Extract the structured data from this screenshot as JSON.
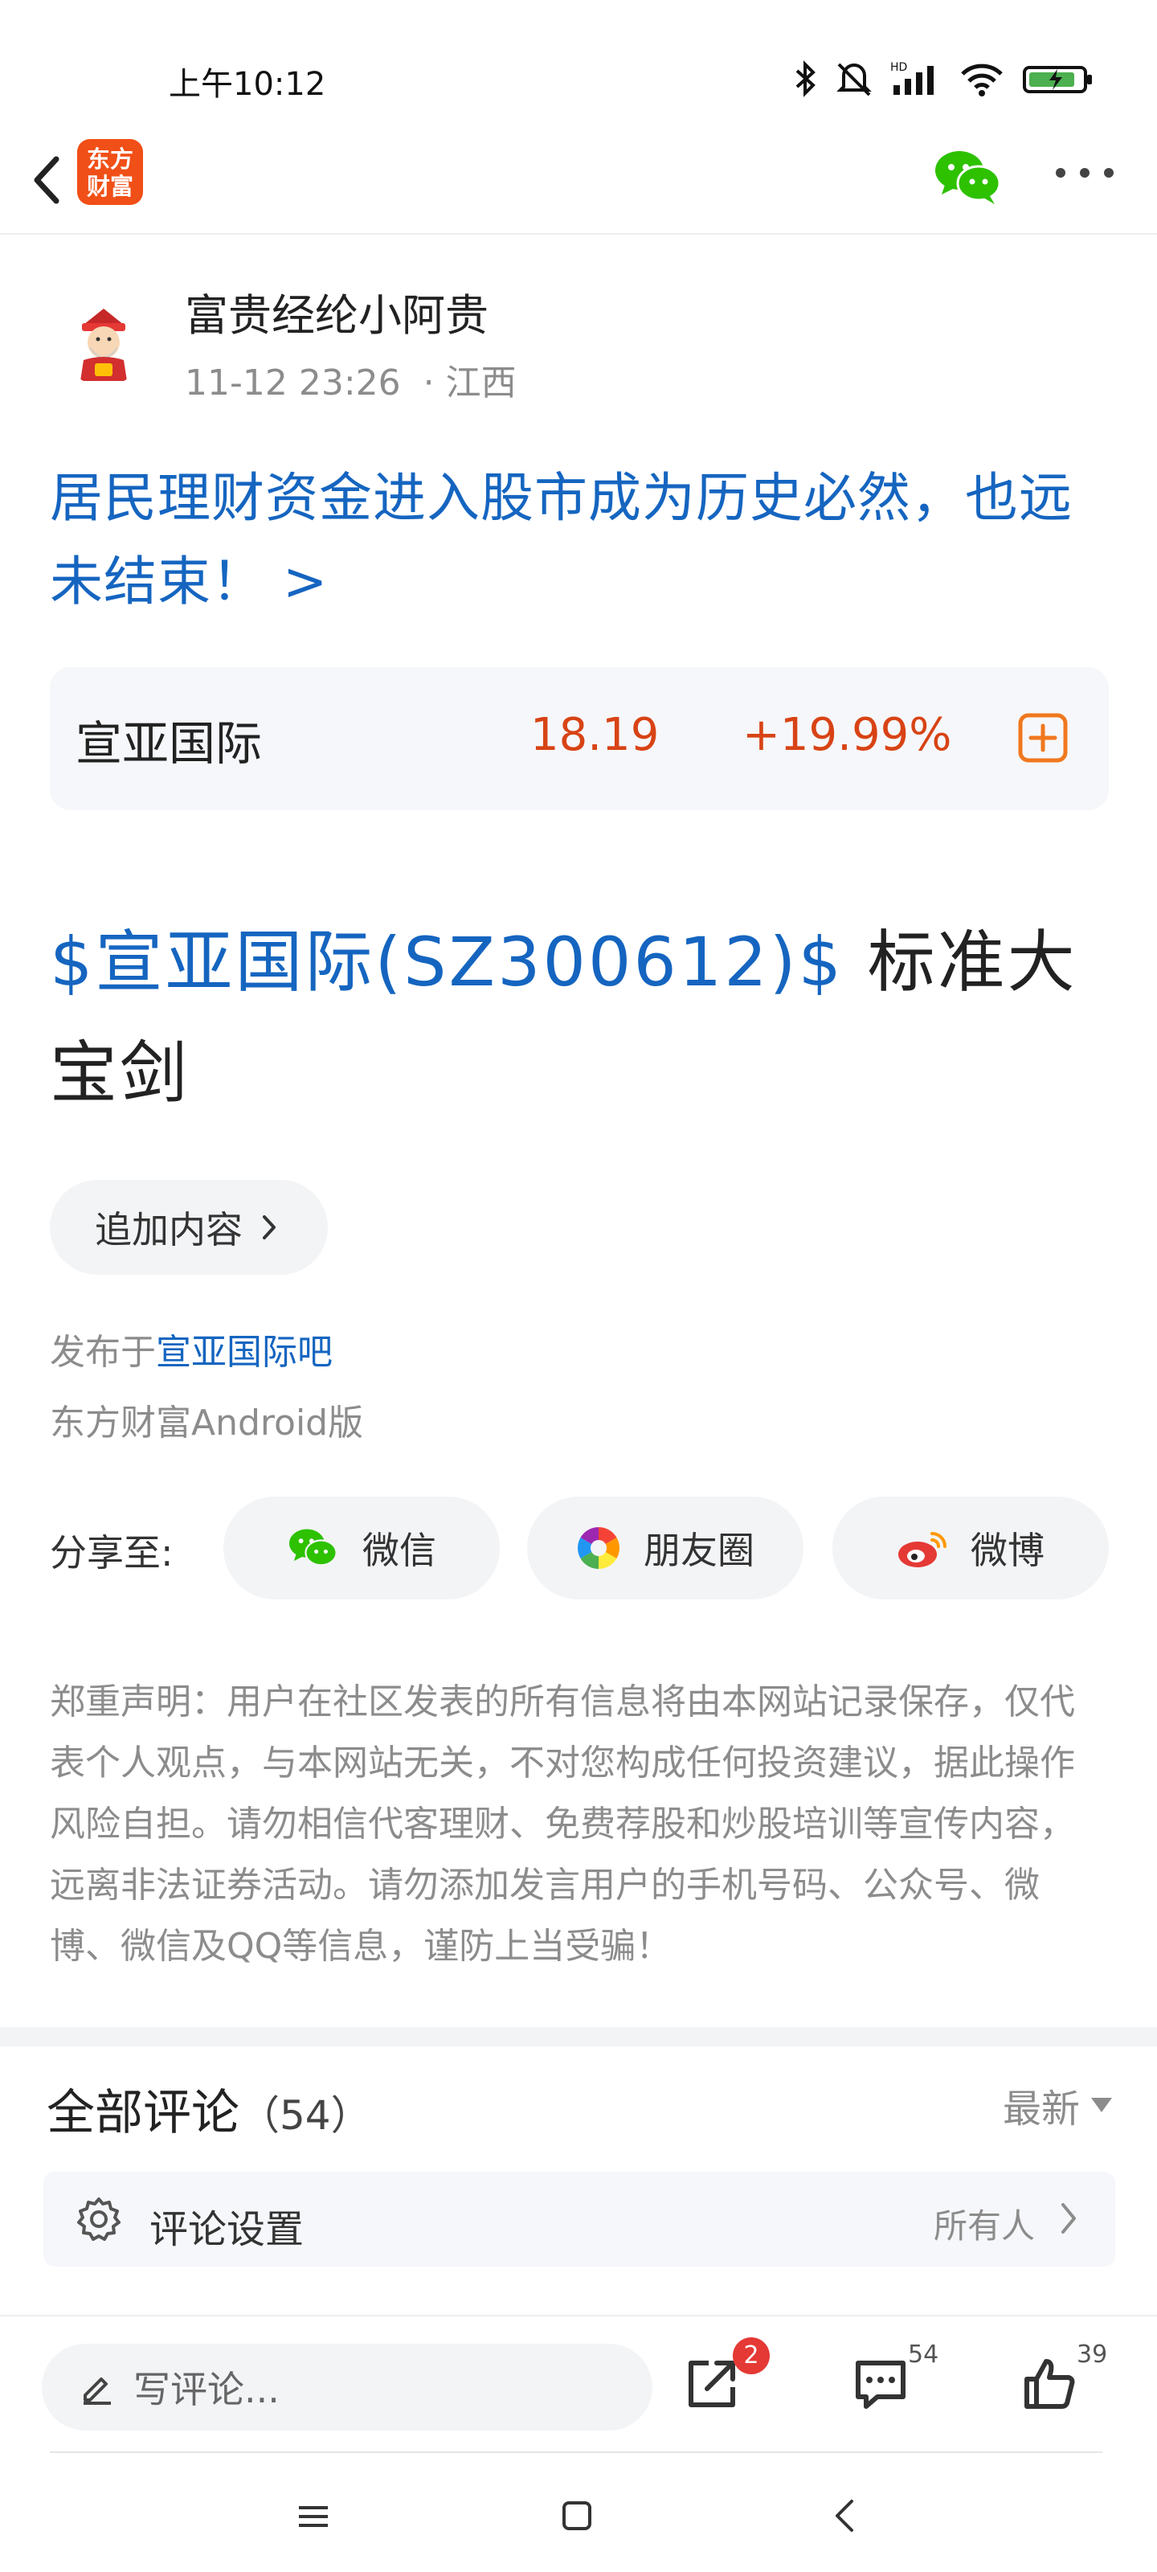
{
  "status_bar": {
    "time": "上午10:12"
  },
  "app": {
    "logo_text_line1": "东方",
    "logo_text_line2": "财富"
  },
  "author": {
    "name": "富贵经纶小阿贵",
    "datetime": "11-12 23:26",
    "location": "· 江西"
  },
  "headline": "居民理财资金进入股市成为历史必然，也远未结束！ >",
  "stock": {
    "name": "宣亚国际",
    "price": "18.19",
    "change": "+19.99%"
  },
  "post": {
    "stock_link": "$宣亚国际(SZ300612)$",
    "text": " 标准大宝剑"
  },
  "append_button": "追加内容",
  "published": {
    "prefix": "发布于",
    "forum": "宣亚国际吧"
  },
  "client": "东方财富Android版",
  "share": {
    "label": "分享至:",
    "wechat": "微信",
    "moments": "朋友圈",
    "weibo": "微博"
  },
  "disclaimer": "郑重声明：用户在社区发表的所有信息将由本网站记录保存，仅代表个人观点，与本网站无关，不对您构成任何投资建议，据此操作风险自担。请勿相信代客理财、免费荐股和炒股培训等宣传内容，远离非法证券活动。请勿添加发言用户的手机号码、公众号、微博、微信及QQ等信息，谨防上当受骗！",
  "comments": {
    "title": "全部评论",
    "count": "（54）",
    "sort": "最新",
    "settings_label": "评论设置",
    "settings_value": "所有人"
  },
  "action_bar": {
    "input_placeholder": "写评论...",
    "share_badge": "2",
    "comment_count": "54",
    "like_count": "39"
  },
  "colors": {
    "link": "#1565c0",
    "rise": "#d84315",
    "brand": "#f04f17",
    "badge": "#e53935"
  }
}
